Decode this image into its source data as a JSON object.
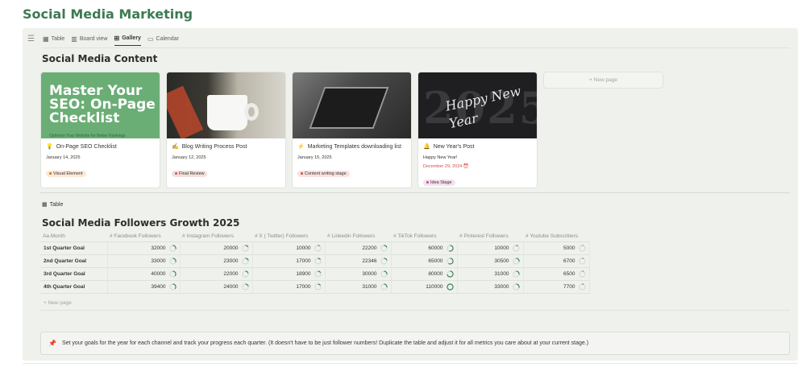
{
  "page": {
    "title": "Social Media Marketing"
  },
  "views": {
    "tabs": [
      {
        "label": "Table",
        "icon": "table-icon"
      },
      {
        "label": "Board view",
        "icon": "board-icon"
      },
      {
        "label": "Gallery",
        "icon": "gallery-icon",
        "active": true
      },
      {
        "label": "Calendar",
        "icon": "calendar-icon"
      }
    ]
  },
  "content": {
    "title": "Social Media Content",
    "cards": [
      {
        "title": "On-Page SEO Checklist",
        "icon": "bulb-icon",
        "date": "January 14, 2025",
        "badge": "Visual Element",
        "badge_color": "#fde8d7",
        "badge_dot": "#d9730d",
        "cover_heading": "Master Your SEO: On-Page Checklist",
        "cover_sub": "Optimize Your Website for Better Rankings"
      },
      {
        "title": "Blog Writing Process Post",
        "icon": "pencil-icon",
        "date": "January 12, 2025",
        "badge": "Final Review",
        "badge_color": "#f3e0dc",
        "badge_dot": "#c4554d"
      },
      {
        "title": "Marketing Templates downloading list",
        "icon": "lightning-icon",
        "date": "January 15, 2025",
        "badge": "Content writing stage",
        "badge_color": "#fbe0e0",
        "badge_dot": "#d44c47"
      },
      {
        "title": "New Year's Post",
        "icon": "bell-icon",
        "subtitle": "Happy New Year!",
        "date": "December 29, 2024",
        "date_overdue": true,
        "badge": "Idea Stage",
        "badge_color": "#f7e0ed",
        "badge_dot": "#c14c8a",
        "cover_year": "2025",
        "cover_script": "Happy New Year"
      }
    ],
    "new_page": "+ New page"
  },
  "followers": {
    "view_label": "Table",
    "title": "Social Media Followers Growth 2025",
    "columns": [
      "Month",
      "Facebook Followers",
      "Instagram Followers",
      "X ( Twitter) Followers",
      "Linkedin Followers",
      "TikTok Followers",
      "Pinterest Followers",
      "Youtube Subscribers"
    ],
    "rows": [
      {
        "month": "1st Quarter Goal",
        "values": [
          "32000",
          "20000",
          "10000",
          "22200",
          "60000",
          "10000",
          "5000"
        ]
      },
      {
        "month": "2nd Quarter Goal",
        "values": [
          "33000",
          "23000",
          "17000",
          "22346",
          "65000",
          "30500",
          "6700"
        ]
      },
      {
        "month": "3rd Quarter Goal",
        "values": [
          "40000",
          "22000",
          "18900",
          "30000",
          "80000",
          "31000",
          "6500"
        ]
      },
      {
        "month": "4th Quarter Goal",
        "values": [
          "39400",
          "24000",
          "17000",
          "31000",
          "110000",
          "33000",
          "7700"
        ]
      }
    ],
    "max": 110000,
    "new_page": "+ New page"
  },
  "callout": {
    "icon": "pushpin-icon",
    "text": "Set your goals for the year for each channel and track your progress each quarter. (It doesn't have to be just follower numbers! Duplicate the table and adjust it for all metrics you care about at your current stage.)"
  },
  "colors": {
    "title_green": "#3d7a53",
    "panel_bg": "#eef1ec",
    "ring": "#2f7d4a"
  }
}
